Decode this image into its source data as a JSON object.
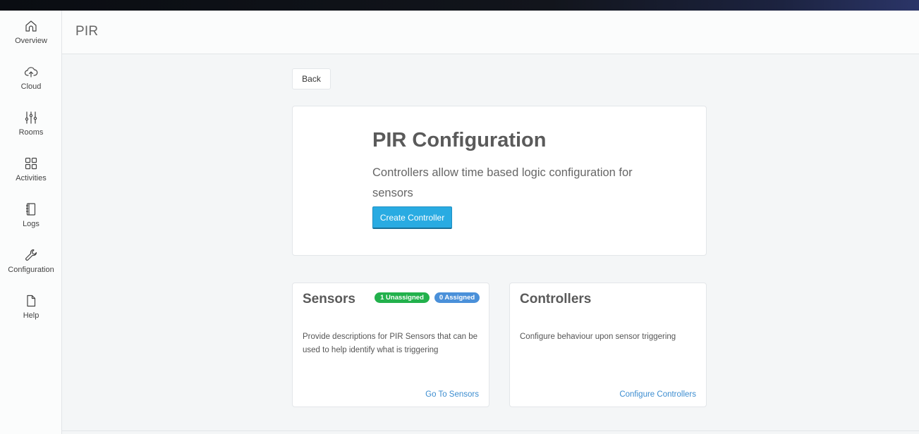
{
  "sidebar": {
    "items": [
      {
        "label": "Overview",
        "icon": "home-icon"
      },
      {
        "label": "Cloud",
        "icon": "cloud-upload-icon"
      },
      {
        "label": "Rooms",
        "icon": "sliders-icon"
      },
      {
        "label": "Activities",
        "icon": "grid-icon"
      },
      {
        "label": "Logs",
        "icon": "notebook-icon"
      },
      {
        "label": "Configuration",
        "icon": "wrench-icon"
      },
      {
        "label": "Help",
        "icon": "file-icon"
      }
    ]
  },
  "header": {
    "title": "PIR"
  },
  "back_label": "Back",
  "hero": {
    "title": "PIR Configuration",
    "description": "Controllers allow time based logic configuration for sensors",
    "button_label": "Create Controller"
  },
  "sensors_card": {
    "title": "Sensors",
    "badge_unassigned": "1 Unassigned",
    "badge_assigned": "0 Assigned",
    "description": "Provide descriptions for PIR Sensors that can be used to help identify what is triggering",
    "link": "Go To Sensors"
  },
  "controllers_card": {
    "title": "Controllers",
    "description": "Configure behaviour upon sensor triggering",
    "link": "Configure Controllers"
  },
  "colors": {
    "accent": "#29abe2",
    "link": "#3c8dd0",
    "badge_green": "#22b14c",
    "badge_blue": "#4a90d9"
  }
}
